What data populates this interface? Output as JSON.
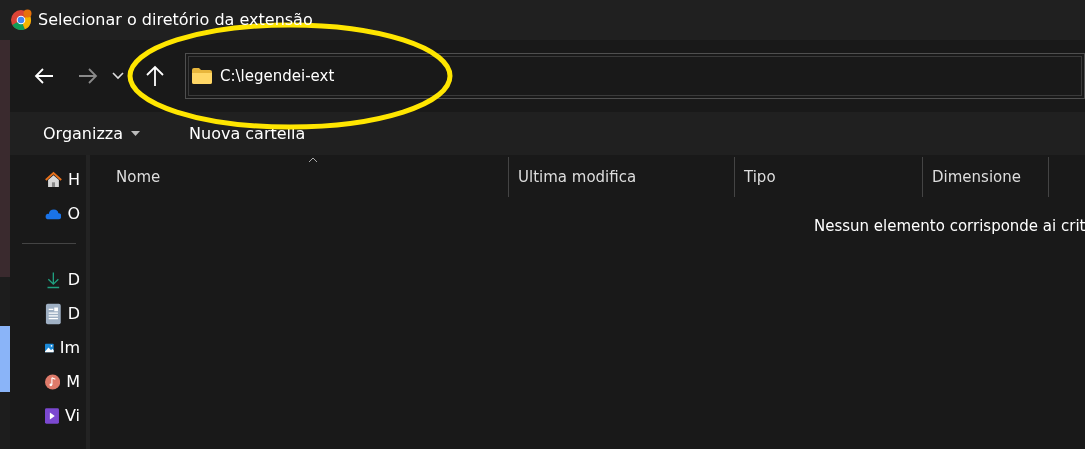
{
  "window": {
    "title": "Selecionar o diretório da extensão"
  },
  "navigation": {
    "back": {
      "disabled": false
    },
    "forward": {
      "disabled": true
    },
    "address": "C:\\legendei-ext"
  },
  "command_bar": [
    {
      "label": "Organizza",
      "kind": "menu"
    },
    {
      "label": "Nuova cartella",
      "kind": "plain"
    }
  ],
  "sidebar": {
    "items": [
      {
        "label": "H",
        "kind": "home"
      },
      {
        "label": "O",
        "kind": "cloud"
      },
      {
        "kind": "separator"
      },
      {
        "label": "D",
        "kind": "download"
      },
      {
        "label": "D",
        "kind": "document"
      },
      {
        "label": "Im",
        "kind": "image"
      },
      {
        "label": "M",
        "kind": "music"
      },
      {
        "label": "Vi",
        "kind": "video"
      }
    ]
  },
  "table": {
    "columns": [
      {
        "label": "Nome",
        "sorted": true
      },
      {
        "label": "Ultima modifica",
        "sorted": false
      },
      {
        "label": "Tipo",
        "sorted": false
      },
      {
        "label": "Dimensione",
        "sorted": false
      }
    ],
    "empty_message": "Nessun elemento corrisponde ai crit"
  },
  "annotation": {
    "kind": "ellipse",
    "color": "#ffe600"
  }
}
